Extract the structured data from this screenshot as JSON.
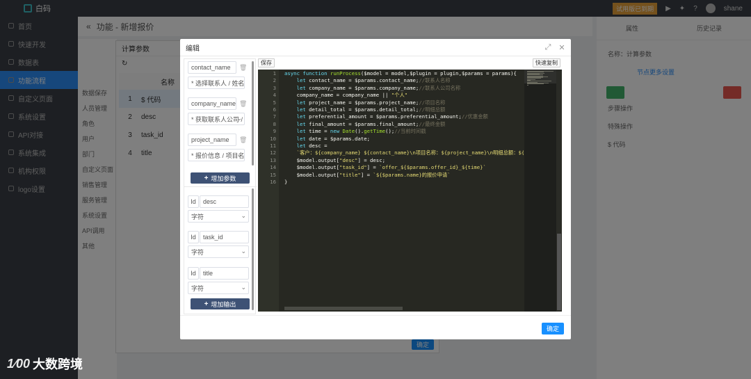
{
  "app": {
    "brand": "白码",
    "trial_badge": "试用版已到期",
    "user": "shane",
    "page_title": "功能 - 新增报价",
    "sidebar": [
      "首页",
      "快速开发",
      "数据表",
      "功能流程",
      "自定义页面",
      "系统设置",
      "API对接",
      "系统集成",
      "机构权限",
      "logo设置"
    ],
    "tree_items": [
      "数据保存",
      "人员管理",
      "角色",
      "用户",
      "部门",
      "自定义页面",
      "销售管理",
      "服务管理",
      "系统设置",
      "API调用",
      "其他"
    ],
    "param_panel_title": "计算参数",
    "param_table_header": "名称",
    "param_rows": [
      {
        "n": "1",
        "name": "$ 代码"
      },
      {
        "n": "2",
        "name": "desc"
      },
      {
        "n": "3",
        "name": "task_id"
      },
      {
        "n": "4",
        "name": "title"
      }
    ],
    "param_panel_ok": "确定",
    "right_tabs": [
      "属性",
      "历史记录"
    ],
    "right_name_label": "名称：计算参数",
    "right_link": "节点更多设置",
    "right_rows": [
      "步骤操作",
      "特殊操作",
      "$ 代码"
    ]
  },
  "dialog": {
    "title": "编辑",
    "save_label": "保存",
    "quick_copy_label": "快速复制",
    "ok_label": "确定",
    "params": [
      {
        "name": "contact_name",
        "source": "* 选择联系人 / 姓名"
      },
      {
        "name": "company_name",
        "source": "* 获取联系人公司 / 名称"
      },
      {
        "name": "project_name",
        "source": "* 报价信息 / 项目名称"
      }
    ],
    "add_param_label": "增加参数",
    "outputs": [
      {
        "id_label": "Id",
        "name": "desc",
        "type": "字符"
      },
      {
        "id_label": "Id",
        "name": "task_id",
        "type": "字符"
      },
      {
        "id_label": "Id",
        "name": "title",
        "type": "字符"
      }
    ],
    "add_output_label": "增加输出",
    "code_lines": [
      {
        "n": "1",
        "code": "async function runProcess($model = model,$plugin = plugin,$params = params){"
      },
      {
        "n": "2",
        "code": "    let contact_name = $params.contact_name;//联系人名称"
      },
      {
        "n": "3",
        "code": "    let company_name = $params.company_name;//联系人公司名称"
      },
      {
        "n": "4",
        "code": "    company_name = company_name || \"个人\""
      },
      {
        "n": "5",
        "code": "    let project_name = $params.project_name;//项目名称"
      },
      {
        "n": "6",
        "code": "    let detail_total = $params.detail_total;//明细总额"
      },
      {
        "n": "7",
        "code": "    let preferential_amount = $params.preferential_amount;//优惠金额"
      },
      {
        "n": "8",
        "code": "    let final_amount = $params.final_amount;//最终金额"
      },
      {
        "n": "9",
        "code": "    let time = new Date().getTime();//当前时间戳"
      },
      {
        "n": "10",
        "code": "    let date = $params.date;"
      },
      {
        "n": "11",
        "code": "    let desc ="
      },
      {
        "n": "12",
        "code": "    `客户：${company_name} ${contact_name}\\n项目名称：${project_name}\\n明细总额：${det"
      },
      {
        "n": "13",
        "code": "    $model.output[\"desc\"] = desc;"
      },
      {
        "n": "14",
        "code": "    $model.output[\"task_id\"] = `offer_${$params.offer_id}_${time}`"
      },
      {
        "n": "15",
        "code": "    $model.output[\"title\"] = `${$params.name}的报价申请`"
      },
      {
        "n": "16",
        "code": "}"
      }
    ]
  },
  "watermark": "大数跨境",
  "colors": {
    "primary": "#1890ff",
    "add_button": "#3e5275",
    "editor_bg": "#272822",
    "sidebar_active": "#2c8ef8"
  }
}
